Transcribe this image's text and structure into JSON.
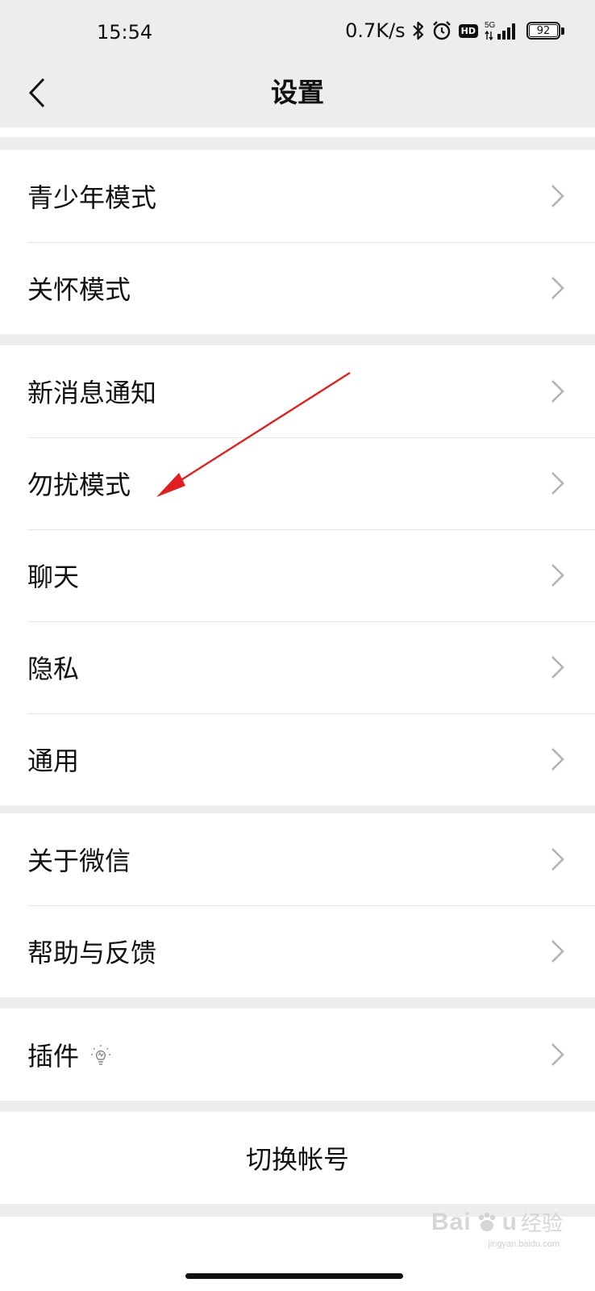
{
  "status_bar": {
    "time": "15:54",
    "net_speed": "0.7K/s",
    "signal_type": "5G",
    "hd_badge": "HD",
    "battery": "92",
    "icons": [
      "bluetooth-icon",
      "alarm-icon",
      "hd-icon",
      "signal-icon",
      "battery-icon"
    ]
  },
  "header": {
    "title": "设置",
    "back_icon": "chevron-left-icon"
  },
  "groups": [
    {
      "items": [
        {
          "label": "青少年模式"
        },
        {
          "label": "关怀模式"
        }
      ]
    },
    {
      "items": [
        {
          "label": "新消息通知"
        },
        {
          "label": "勿扰模式"
        },
        {
          "label": "聊天"
        },
        {
          "label": "隐私"
        },
        {
          "label": "通用"
        }
      ]
    },
    {
      "items": [
        {
          "label": "关于微信"
        },
        {
          "label": "帮助与反馈"
        }
      ]
    },
    {
      "items": [
        {
          "label": "插件",
          "icon": "lightbulb-icon"
        }
      ]
    }
  ],
  "switch_account": "切换帐号",
  "annotation": {
    "color": "#e02020",
    "target": "勿扰模式"
  },
  "watermark": {
    "brand": "Bai",
    "brand_end": "u",
    "cn": "经验",
    "url": "jingyan.baidu.com"
  },
  "colors": {
    "page_bg": "#ededed",
    "row_bg": "#ffffff",
    "text": "#111111",
    "chevron": "#b2b2b2",
    "divider": "#e6e6e6"
  }
}
